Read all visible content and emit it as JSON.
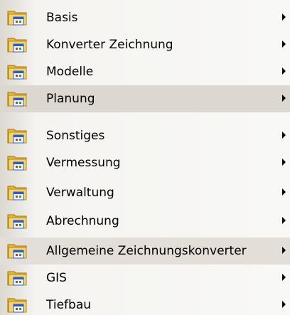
{
  "menu": {
    "items": [
      {
        "label": "Basis",
        "icon": "folder-app-icon",
        "submenu": true,
        "state": "normal"
      },
      {
        "label": "Konverter Zeichnung",
        "icon": "folder-app-icon",
        "submenu": true,
        "state": "normal"
      },
      {
        "label": "Modelle",
        "icon": "folder-app-icon",
        "submenu": true,
        "state": "normal"
      },
      {
        "label": "Planung",
        "icon": "folder-app-icon",
        "submenu": true,
        "state": "highlighted"
      },
      {
        "label": "Sonstiges",
        "icon": "folder-app-icon",
        "submenu": true,
        "state": "normal"
      },
      {
        "label": "Vermessung",
        "icon": "folder-app-icon",
        "submenu": true,
        "state": "normal"
      },
      {
        "label": "Verwaltung",
        "icon": "folder-app-icon",
        "submenu": true,
        "state": "normal"
      },
      {
        "label": "Abrechnung",
        "icon": "folder-app-icon",
        "submenu": true,
        "state": "normal"
      },
      {
        "label": "Allgemeine Zeichnungskonverter",
        "icon": "folder-app-icon",
        "submenu": true,
        "state": "highlighted"
      },
      {
        "label": "GIS",
        "icon": "folder-app-icon",
        "submenu": true,
        "state": "normal"
      },
      {
        "label": "Tiefbau",
        "icon": "folder-app-icon",
        "submenu": true,
        "state": "normal"
      }
    ]
  },
  "colors": {
    "highlight": "#dcd7cf",
    "folder_yellow": "#f2c64a",
    "window_blue": "#2a5cc8"
  }
}
